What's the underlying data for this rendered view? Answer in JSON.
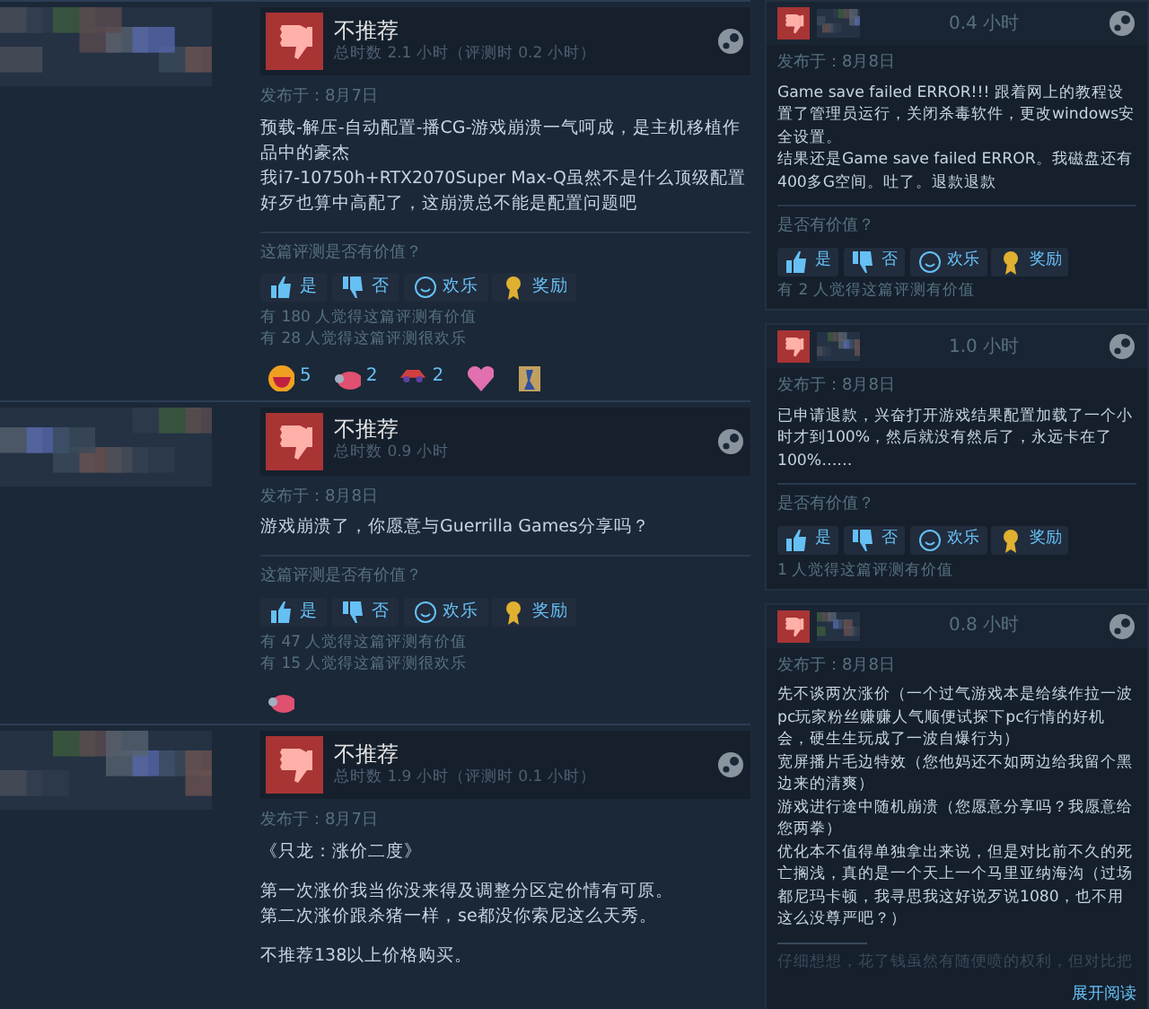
{
  "reviews": [
    {
      "recommendation": "不推荐",
      "playtime": "总时数 2.1 小时（评测时 0.2 小时）",
      "posted": "发布于：8月7日",
      "body": [
        [
          "预载-解压-自动配置-播CG-游戏崩溃一气呵成，是主机移植作品中的豪杰",
          "我i7-10750h+RTX2070Super Max-Q虽然不是什么顶级配置好歹也算中高配了，这崩溃总不能是配置问题吧"
        ]
      ],
      "helpful_prompt": "这篇评测是否有价值？",
      "buttons": [
        {
          "kind": "yes",
          "label": "是"
        },
        {
          "kind": "no",
          "label": "否"
        },
        {
          "kind": "funny",
          "label": "欢乐"
        },
        {
          "kind": "award",
          "label": "奖励"
        }
      ],
      "counts": [
        "有 180 人觉得这篇评测有价值",
        "有 28 人觉得这篇评测很欢乐"
      ],
      "awards": [
        {
          "kind": "laugh",
          "count": "5"
        },
        {
          "kind": "pig",
          "count": "2"
        },
        {
          "kind": "car",
          "count": "2"
        },
        {
          "kind": "heart"
        },
        {
          "kind": "figure"
        }
      ]
    },
    {
      "recommendation": "不推荐",
      "playtime": "总时数 0.9 小时",
      "posted": "发布于：8月8日",
      "body": [
        [
          "游戏崩溃了，你愿意与Guerrilla Games分享吗？"
        ]
      ],
      "helpful_prompt": "这篇评测是否有价值？",
      "buttons": [
        {
          "kind": "yes",
          "label": "是"
        },
        {
          "kind": "no",
          "label": "否"
        },
        {
          "kind": "funny",
          "label": "欢乐"
        },
        {
          "kind": "award",
          "label": "奖励"
        }
      ],
      "counts": [
        "有 47 人觉得这篇评测有价值",
        "有 15 人觉得这篇评测很欢乐"
      ],
      "awards": [
        {
          "kind": "pig"
        }
      ]
    },
    {
      "recommendation": "不推荐",
      "playtime": "总时数 1.9 小时（评测时 0.1 小时）",
      "posted": "发布于：8月7日",
      "body": [
        [
          "《只龙：涨价二度》"
        ],
        [
          "第一次涨价我当你没来得及调整分区定价情有可原。",
          "第二次涨价跟杀猪一样，se都没你索尼这么天秀。"
        ],
        [
          "不推荐138以上价格购买。"
        ]
      ]
    }
  ],
  "side_reviews": [
    {
      "hours": "0.4 小时",
      "posted": "发布于：8月8日",
      "body": [
        "Game save failed ERROR!!! 跟着网上的教程设置了管理员运行，关闭杀毒软件，更改windows安全设置。",
        "结果还是Game save failed ERROR。我磁盘还有400多G空间。吐了。退款退款"
      ],
      "helpful_prompt": "是否有价值？",
      "buttons": [
        {
          "kind": "yes",
          "label": "是"
        },
        {
          "kind": "no",
          "label": "否"
        },
        {
          "kind": "funny",
          "label": "欢乐"
        },
        {
          "kind": "award",
          "label": "奖励"
        }
      ],
      "counts": [
        "有 2 人觉得这篇评测有价值"
      ]
    },
    {
      "hours": "1.0 小时",
      "posted": "发布于：8月8日",
      "body": [
        "已申请退款，兴奋打开游戏结果配置加载了一个小时才到100%，然后就没有然后了，永远卡在了100%……"
      ],
      "helpful_prompt": "是否有价值？",
      "buttons": [
        {
          "kind": "yes",
          "label": "是"
        },
        {
          "kind": "no",
          "label": "否"
        },
        {
          "kind": "funny",
          "label": "欢乐"
        },
        {
          "kind": "award",
          "label": "奖励"
        }
      ],
      "counts": [
        "1 人觉得这篇评测有价值"
      ]
    },
    {
      "hours": "0.8 小时",
      "posted": "发布于：8月8日",
      "body": [
        "先不谈两次涨价（一个过气游戏本是给续作拉一波pc玩家粉丝赚赚人气顺便试探下pc行情的好机会，硬生生玩成了一波自爆行为）",
        "宽屏播片毛边特效（您他妈还不如两边给我留个黑边来的清爽）",
        "游戏进行途中随机崩溃（您愿意分享吗？我愿意给您两拳）",
        "优化本不值得单独拿出来说，但是对比前不久的死亡搁浅，真的是一个天上一个马里亚纳海沟（过场都尼玛卡顿，我寻思我这好说歹说1080，也不用这么没尊严吧？）"
      ],
      "faded_preview": "仔细想想，花了钱虽然有随便喷的权利，但对比把",
      "read_more": "展开阅读"
    }
  ]
}
